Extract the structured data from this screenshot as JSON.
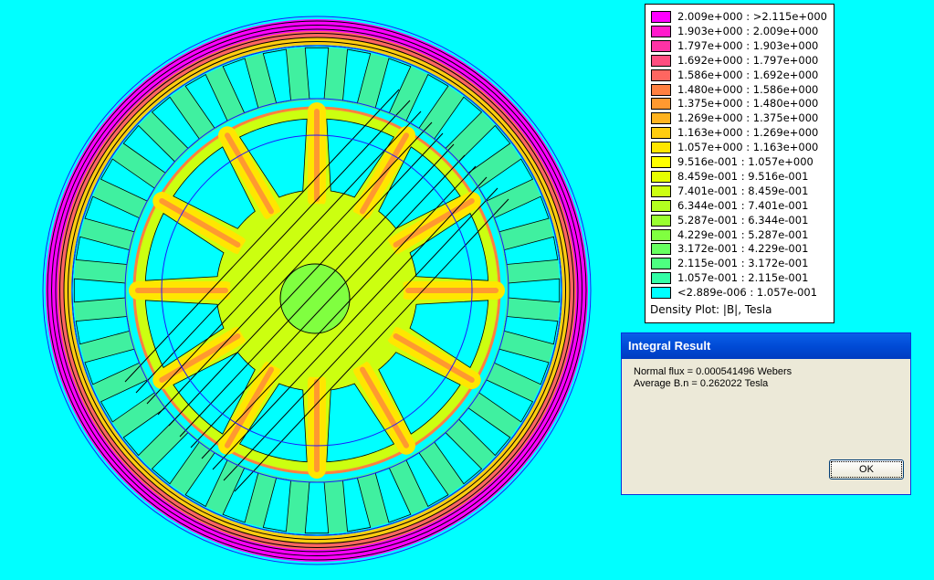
{
  "legend": {
    "title": "Density Plot: |B|, Tesla",
    "entries": [
      {
        "label": "2.009e+000 : >2.115e+000",
        "color": "#ff00ff"
      },
      {
        "label": "1.903e+000 : 2.009e+000",
        "color": "#ff1acc"
      },
      {
        "label": "1.797e+000 : 1.903e+000",
        "color": "#ff33a5"
      },
      {
        "label": "1.692e+000 : 1.797e+000",
        "color": "#ff4d80"
      },
      {
        "label": "1.586e+000 : 1.692e+000",
        "color": "#ff6660"
      },
      {
        "label": "1.480e+000 : 1.586e+000",
        "color": "#ff8040"
      },
      {
        "label": "1.375e+000 : 1.480e+000",
        "color": "#ff9930"
      },
      {
        "label": "1.269e+000 : 1.375e+000",
        "color": "#ffb320"
      },
      {
        "label": "1.163e+000 : 1.269e+000",
        "color": "#ffcc10"
      },
      {
        "label": "1.057e+000 : 1.163e+000",
        "color": "#ffe600"
      },
      {
        "label": "9.516e-001 : 1.057e+000",
        "color": "#ffff00"
      },
      {
        "label": "8.459e-001 : 9.516e-001",
        "color": "#e6ff00"
      },
      {
        "label": "7.401e-001 : 8.459e-001",
        "color": "#ccff10"
      },
      {
        "label": "6.344e-001 : 7.401e-001",
        "color": "#b3ff20"
      },
      {
        "label": "5.287e-001 : 6.344e-001",
        "color": "#99ff30"
      },
      {
        "label": "4.229e-001 : 5.287e-001",
        "color": "#80ff40"
      },
      {
        "label": "3.172e-001 : 4.229e-001",
        "color": "#66ff60"
      },
      {
        "label": "2.115e-001 : 3.172e-001",
        "color": "#4dff80"
      },
      {
        "label": "1.057e-001 : 2.115e-001",
        "color": "#33ffa5"
      },
      {
        "label": "<2.889e-006 : 1.057e-001",
        "color": "#00ffff"
      }
    ]
  },
  "dialog": {
    "title": "Integral Result",
    "lines": [
      "Normal flux = 0.000541496 Webers",
      "Average B.n = 0.262022 Tesla"
    ],
    "ok_label": "OK"
  },
  "colors": {
    "background": "#00ffff",
    "stator_teeth": "#40f0a0",
    "rotor_core": "#ccff10",
    "rotor_arms": "#ffe600",
    "outer_ring": "#ff00ff",
    "flux_lines": "#000000",
    "mesh_lines": "#1a1aff"
  },
  "geometry_notes": {
    "stator_slots": 36,
    "rotor_arms": 12
  }
}
